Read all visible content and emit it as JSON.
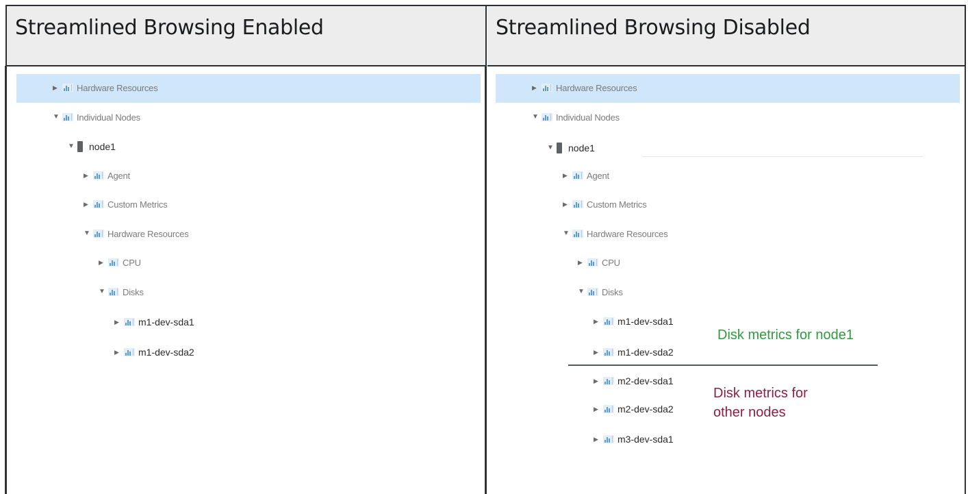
{
  "headers": {
    "left": "Streamlined Browsing Enabled",
    "right": "Streamlined Browsing Disabled"
  },
  "tree_left": [
    {
      "label": "Hardware Resources",
      "expanded": false,
      "selected": true
    },
    {
      "label": "Individual Nodes",
      "expanded": true
    },
    {
      "label": "node1",
      "expanded": true
    },
    {
      "label": "Agent",
      "expanded": false
    },
    {
      "label": "Custom Metrics",
      "expanded": false
    },
    {
      "label": "Hardware Resources",
      "expanded": true
    },
    {
      "label": "CPU",
      "expanded": false
    },
    {
      "label": "Disks",
      "expanded": true
    },
    {
      "label": "m1-dev-sda1",
      "expanded": false
    },
    {
      "label": "m1-dev-sda2",
      "expanded": false
    }
  ],
  "tree_right": [
    {
      "label": "Hardware Resources",
      "expanded": false,
      "selected": true
    },
    {
      "label": "Individual Nodes",
      "expanded": true
    },
    {
      "label": "node1",
      "expanded": true
    },
    {
      "label": "Agent",
      "expanded": false
    },
    {
      "label": "Custom Metrics",
      "expanded": false
    },
    {
      "label": "Hardware Resources",
      "expanded": true
    },
    {
      "label": "CPU",
      "expanded": false
    },
    {
      "label": "Disks",
      "expanded": true
    },
    {
      "label": "m1-dev-sda1",
      "expanded": false
    },
    {
      "label": "m1-dev-sda2",
      "expanded": false
    },
    {
      "label": "m2-dev-sda1",
      "expanded": false
    },
    {
      "label": "m2-dev-sda2",
      "expanded": false
    },
    {
      "label": "m3-dev-sda1",
      "expanded": false
    }
  ],
  "annotations": {
    "node1_disks": "Disk metrics for node1",
    "other_disks_line1": "Disk metrics for",
    "other_disks_line2": "other nodes"
  },
  "colors": {
    "selection": "#cfe6fb",
    "annotation_green": "#2f9a3f",
    "annotation_purple": "#8c1f45"
  },
  "icons": {
    "collapsed": "triangle-right-icon",
    "expanded": "triangle-down-icon",
    "metric_folder": "metric-folder-icon",
    "node": "server-icon"
  }
}
